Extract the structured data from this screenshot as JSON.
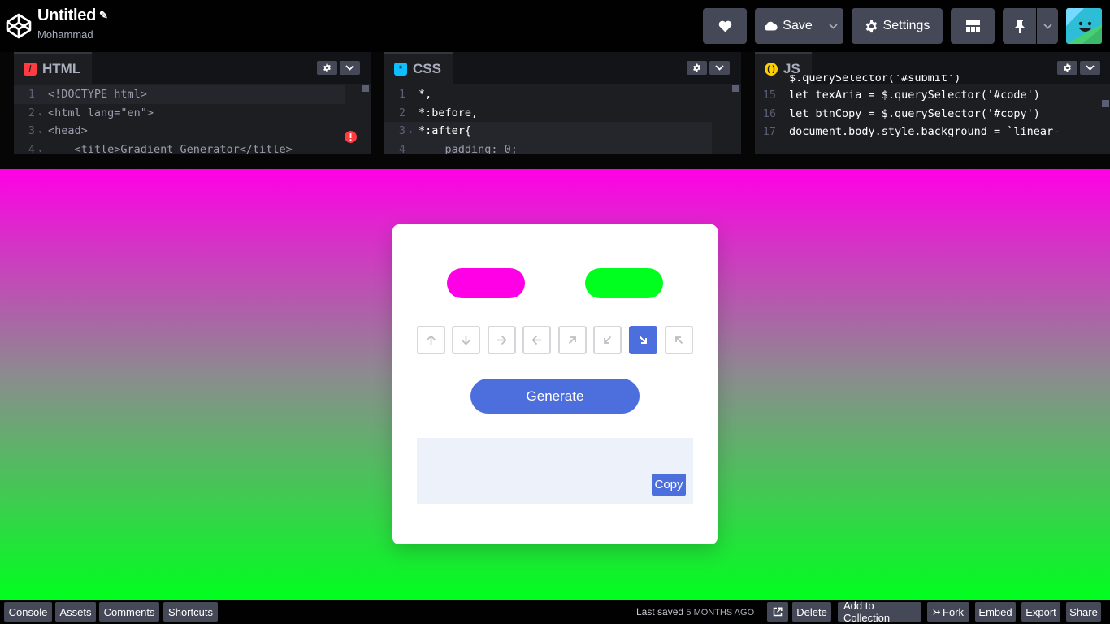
{
  "header": {
    "title": "Untitled",
    "author": "Mohammad",
    "save_label": "Save",
    "settings_label": "Settings",
    "icons": [
      "codepen-logo-icon",
      "pencil-icon",
      "heart-icon",
      "cloud-icon",
      "chevron-down-icon",
      "gear-icon",
      "layout-grid-icon",
      "pin-icon",
      "chevron-down-icon",
      "avatar"
    ]
  },
  "editors": {
    "html": {
      "label": "HTML",
      "icon_color": "#ff3c41",
      "lines": [
        {
          "n": "1",
          "text": "<!DOCTYPE html>"
        },
        {
          "n": "2",
          "text": "<html lang=\"en\">"
        },
        {
          "n": "3",
          "text": "<head>"
        },
        {
          "n": "4",
          "text": "    <title>Gradient Generator</title>"
        }
      ]
    },
    "css": {
      "label": "CSS",
      "icon_color": "#0ebeff",
      "lines": [
        {
          "n": "1",
          "text": "*,"
        },
        {
          "n": "2",
          "text": "*:before,"
        },
        {
          "n": "3",
          "text": "*:after{"
        },
        {
          "n": "4",
          "text": "    padding: 0;"
        }
      ]
    },
    "js": {
      "label": "JS",
      "icon_color": "#fcd000",
      "lines": [
        {
          "n": "",
          "text": "$.querySelector('#submit')"
        },
        {
          "n": "15",
          "text": "let texAria = $.querySelector('#code')"
        },
        {
          "n": "16",
          "text": "let btnCopy = $.querySelector('#copy')"
        },
        {
          "n": "17",
          "text": "document.body.style.background = `linear-"
        }
      ]
    }
  },
  "preview": {
    "gradient": {
      "from": "#ff00e6",
      "to": "#00ff1e",
      "direction": "to bottom"
    },
    "color1": "#ff00e6",
    "color2": "#00ff1e",
    "directions": [
      {
        "icon": "arrow-up-icon",
        "active": false
      },
      {
        "icon": "arrow-down-icon",
        "active": false
      },
      {
        "icon": "arrow-right-icon",
        "active": false
      },
      {
        "icon": "arrow-left-icon",
        "active": false
      },
      {
        "icon": "arrow-up-right-icon",
        "active": false
      },
      {
        "icon": "arrow-down-left-icon",
        "active": false
      },
      {
        "icon": "arrow-down-right-icon",
        "active": true
      },
      {
        "icon": "arrow-up-left-icon",
        "active": false
      }
    ],
    "generate_label": "Generate",
    "copy_label": "Copy",
    "accent": "#4d6fdd"
  },
  "footer": {
    "console": "Console",
    "assets": "Assets",
    "comments": "Comments",
    "shortcuts": "Shortcuts",
    "last_saved": "Last saved",
    "saved_ago": "5 MONTHS AGO",
    "delete": "Delete",
    "add_to_collection": "Add to Collection",
    "fork": "Fork",
    "embed": "Embed",
    "export": "Export",
    "share": "Share"
  }
}
